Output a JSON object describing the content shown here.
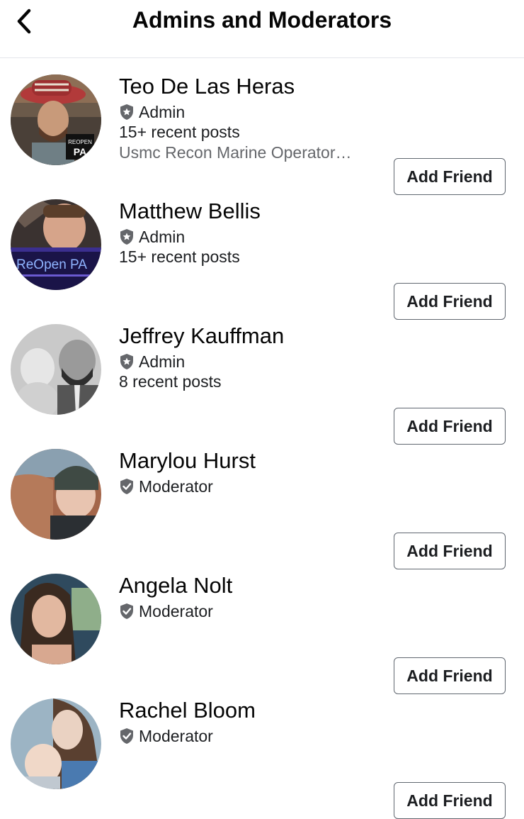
{
  "header": {
    "title": "Admins and Moderators",
    "back_icon": "chevron-left-icon"
  },
  "members": [
    {
      "name": "Teo De Las Heras",
      "role": "Admin",
      "posts": "15+ recent posts",
      "bio": "Usmc Recon Marine Operator…",
      "button": "Add Friend"
    },
    {
      "name": "Matthew Bellis",
      "role": "Admin",
      "posts": "15+ recent posts",
      "button": "Add Friend"
    },
    {
      "name": "Jeffrey Kauffman",
      "role": "Admin",
      "posts": "8 recent posts",
      "button": "Add Friend"
    },
    {
      "name": "Marylou Hurst",
      "role": "Moderator",
      "button": "Add Friend"
    },
    {
      "name": "Angela Nolt",
      "role": "Moderator",
      "button": "Add Friend"
    },
    {
      "name": "Rachel Bloom",
      "role": "Moderator",
      "button": "Add Friend"
    }
  ],
  "avatar_text": {
    "teo": [
      "REOPEN",
      "PA"
    ],
    "matthew": "ReOpen PA"
  },
  "colors": {
    "role_icon": "#65676b",
    "muted_text": "#65676b",
    "button_border": "#606770"
  }
}
